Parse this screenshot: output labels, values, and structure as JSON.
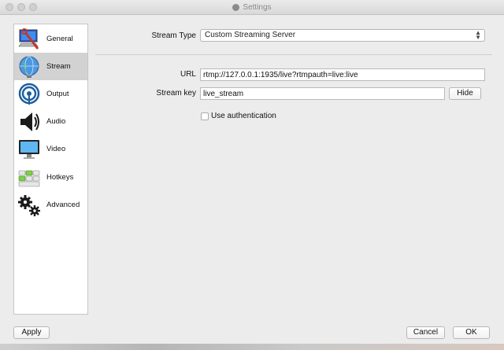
{
  "window": {
    "title": "Settings"
  },
  "sidebar": {
    "items": [
      {
        "label": "General",
        "icon": "computer-wrench-icon",
        "selected": false
      },
      {
        "label": "Stream",
        "icon": "globe-icon",
        "selected": true
      },
      {
        "label": "Output",
        "icon": "broadcast-icon",
        "selected": false
      },
      {
        "label": "Audio",
        "icon": "speaker-icon",
        "selected": false
      },
      {
        "label": "Video",
        "icon": "monitor-icon",
        "selected": false
      },
      {
        "label": "Hotkeys",
        "icon": "keyboard-icon",
        "selected": false
      },
      {
        "label": "Advanced",
        "icon": "gears-icon",
        "selected": false
      }
    ]
  },
  "stream": {
    "stream_type_label": "Stream Type",
    "stream_type_value": "Custom Streaming Server",
    "url_label": "URL",
    "url_value": "rtmp://127.0.0.1:1935/live?rtmpauth=live:live",
    "stream_key_label": "Stream key",
    "stream_key_value": "live_stream",
    "hide_label": "Hide",
    "use_auth_label": "Use authentication",
    "use_auth_checked": false
  },
  "footer": {
    "apply_label": "Apply",
    "cancel_label": "Cancel",
    "ok_label": "OK"
  }
}
